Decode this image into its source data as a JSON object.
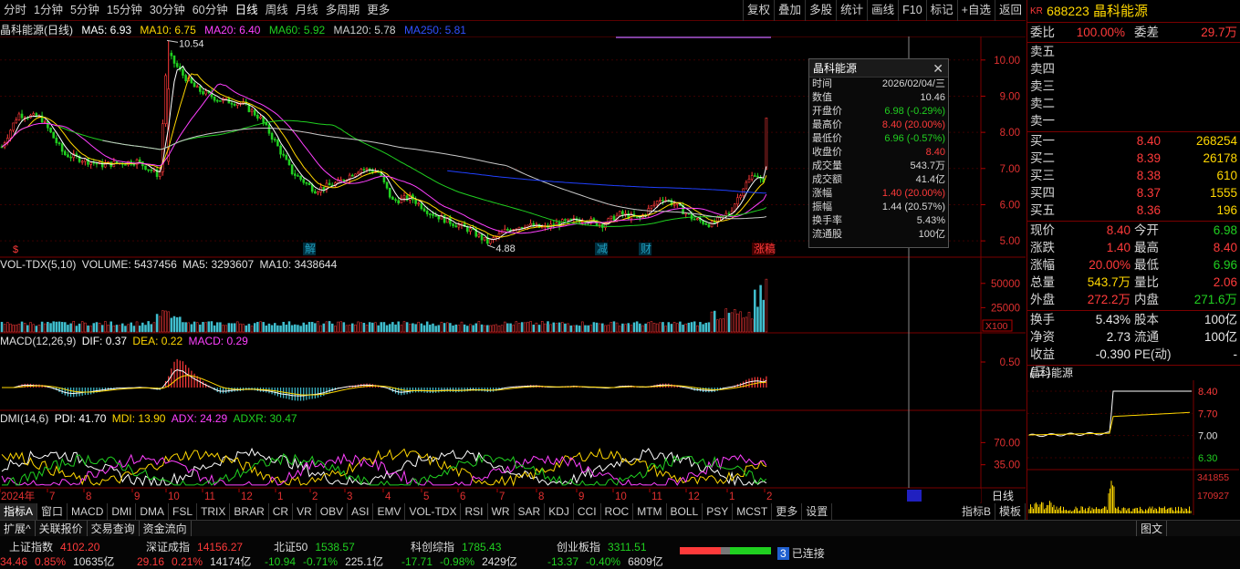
{
  "toolbar": {
    "periods": [
      "分时",
      "1分钟",
      "5分钟",
      "15分钟",
      "30分钟",
      "60分钟",
      "日线",
      "周线",
      "月线",
      "多周期",
      "更多"
    ],
    "active_period": "日线",
    "right_tools": [
      "复权",
      "叠加",
      "多股",
      "统计",
      "画线",
      "F10",
      "标记",
      "+自选",
      "返回"
    ]
  },
  "chart_title": {
    "name": "晶科能源(日线)",
    "ma5": "MA5: 6.93",
    "ma10": "MA10: 6.75",
    "ma20": "MA20: 6.40",
    "ma60": "MA60: 5.92",
    "ma120": "MA120: 5.78",
    "ma250": "MA250: 5.81"
  },
  "colors": {
    "up": "#ff3a3a",
    "down": "#20d020",
    "ma5": "#ffffff",
    "ma10": "#ffd700",
    "ma20": "#ff40ff",
    "ma60": "#20d020",
    "ma120": "#c8c8c8",
    "ma250": "#2040ff",
    "panel_border": "#7a0000",
    "gold": "#ffd700"
  },
  "price_axis": [
    "10.00",
    "9.00",
    "8.00",
    "7.00",
    "6.00",
    "5.00"
  ],
  "chart_annotations": {
    "high": "10.54",
    "low": "4.88",
    "markers": [
      "解",
      "减",
      "财",
      "涨稿"
    ]
  },
  "volume_panel": {
    "label": "VOL-TDX(5,10)",
    "volume": "VOLUME: 5437456",
    "ma5": "MA5: 3293607",
    "ma10": "MA10: 3438644",
    "axis": [
      "50000",
      "25000"
    ],
    "unit": "X100"
  },
  "macd_panel": {
    "label": "MACD(12,26,9)",
    "dif": "DIF: 0.37",
    "dea": "DEA: 0.22",
    "macd": "MACD: 0.29",
    "axis": [
      "0.50"
    ]
  },
  "dmi_panel": {
    "label": "DMI(14,6)",
    "pdi": "PDI: 41.70",
    "mdi": "MDI: 13.90",
    "adx": "ADX: 24.29",
    "adxr": "ADXR: 30.47",
    "axis": [
      "70.00",
      "35.00"
    ]
  },
  "date_axis": {
    "labels": [
      "2024年",
      "7",
      "8",
      "9",
      "10",
      "11",
      "12",
      "1",
      "2",
      "3",
      "4",
      "5",
      "6",
      "7",
      "8",
      "9",
      "10",
      "11",
      "12",
      "1",
      "2"
    ],
    "tag": "日线"
  },
  "popup": {
    "title": "晶科能源",
    "rows": [
      {
        "k": "时间",
        "v": "2026/02/04/三",
        "c": ""
      },
      {
        "k": "数值",
        "v": "10.46",
        "c": ""
      },
      {
        "k": "开盘价",
        "v": "6.98 (-0.29%)",
        "c": "green"
      },
      {
        "k": "最高价",
        "v": "8.40 (20.00%)",
        "c": "red"
      },
      {
        "k": "最低价",
        "v": "6.96 (-0.57%)",
        "c": "green"
      },
      {
        "k": "收盘价",
        "v": "8.40",
        "c": "red"
      },
      {
        "k": "成交量",
        "v": "543.7万",
        "c": ""
      },
      {
        "k": "成交额",
        "v": "41.4亿",
        "c": ""
      },
      {
        "k": "涨幅",
        "v": "1.40 (20.00%)",
        "c": "red"
      },
      {
        "k": "振幅",
        "v": "1.44 (20.57%)",
        "c": ""
      },
      {
        "k": "换手率",
        "v": "5.43%",
        "c": ""
      },
      {
        "k": "流通股",
        "v": "100亿",
        "c": ""
      }
    ]
  },
  "indicator_tabs": [
    "指标A",
    "窗口",
    "MACD",
    "DMI",
    "DMA",
    "FSL",
    "TRIX",
    "BRAR",
    "CR",
    "VR",
    "OBV",
    "ASI",
    "EMV",
    "VOL-TDX",
    "RSI",
    "WR",
    "SAR",
    "KDJ",
    "CCI",
    "ROC",
    "MTM",
    "BOLL",
    "PSY",
    "MCST",
    "更多",
    "设置"
  ],
  "indicator_right": [
    "指标B",
    "模板"
  ],
  "bottom_tabs": [
    "扩展^",
    "关联报价",
    "交易查询",
    "资金流向"
  ],
  "bottom_right": "图文",
  "quote": {
    "badge": "KR",
    "code": "688223",
    "name": "晶科能源",
    "weibi_label": "委比",
    "weibi": "100.00%",
    "weicha_label": "委差",
    "weicha": "29.7万",
    "sells": [
      {
        "label": "卖五",
        "price": "",
        "vol": ""
      },
      {
        "label": "卖四",
        "price": "",
        "vol": ""
      },
      {
        "label": "卖三",
        "price": "",
        "vol": ""
      },
      {
        "label": "卖二",
        "price": "",
        "vol": ""
      },
      {
        "label": "卖一",
        "price": "",
        "vol": ""
      }
    ],
    "buys": [
      {
        "label": "买一",
        "price": "8.40",
        "vol": "268254"
      },
      {
        "label": "买二",
        "price": "8.39",
        "vol": "26178"
      },
      {
        "label": "买三",
        "price": "8.38",
        "vol": "610"
      },
      {
        "label": "买四",
        "price": "8.37",
        "vol": "1555"
      },
      {
        "label": "买五",
        "price": "8.36",
        "vol": "196"
      }
    ],
    "stats": [
      {
        "l1": "现价",
        "v1": "8.40",
        "c1": "red",
        "l2": "今开",
        "v2": "6.98",
        "c2": "green"
      },
      {
        "l1": "涨跌",
        "v1": "1.40",
        "c1": "red",
        "l2": "最高",
        "v2": "8.40",
        "c2": "red"
      },
      {
        "l1": "涨幅",
        "v1": "20.00%",
        "c1": "red",
        "l2": "最低",
        "v2": "6.96",
        "c2": "green"
      },
      {
        "l1": "总量",
        "v1": "543.7万",
        "c1": "yellow",
        "l2": "量比",
        "v2": "2.06",
        "c2": "red"
      },
      {
        "l1": "外盘",
        "v1": "272.2万",
        "c1": "red",
        "l2": "内盘",
        "v2": "271.6万",
        "c2": "green"
      }
    ],
    "stats2": [
      {
        "l1": "换手",
        "v1": "5.43%",
        "c1": "white",
        "l2": "股本",
        "v2": "100亿",
        "c2": "white"
      },
      {
        "l1": "净资",
        "v1": "2.73",
        "c1": "white",
        "l2": "流通",
        "v2": "100亿",
        "c2": "white"
      },
      {
        "l1": "收益(三)",
        "v1": "-0.390",
        "c1": "white",
        "l2": "PE(动)",
        "v2": "-",
        "c2": "white"
      }
    ],
    "mini_title": "晶科能源",
    "mini_axis": [
      "8.40",
      "7.70",
      "7.00",
      "6.30"
    ],
    "mini_vol_axis": [
      "341855",
      "170927"
    ]
  },
  "status": {
    "indices": [
      {
        "name": "上证指数",
        "value": "4102.20",
        "chg": "34.46",
        "pct": "0.85%",
        "amt": "10635亿",
        "c": "red"
      },
      {
        "name": "深证成指",
        "value": "14156.27",
        "chg": "29.16",
        "pct": "0.21%",
        "amt": "14174亿",
        "c": "red"
      },
      {
        "name": "北证50",
        "value": "1538.57",
        "chg": "-10.94",
        "pct": "-0.71%",
        "amt": "225.1亿",
        "c": "green"
      },
      {
        "name": "科创综指",
        "value": "1785.43",
        "chg": "-17.71",
        "pct": "-0.98%",
        "amt": "2429亿",
        "c": "green"
      },
      {
        "name": "创业板指",
        "value": "3311.51",
        "chg": "-13.37",
        "pct": "-0.40%",
        "amt": "6809亿",
        "c": "green"
      }
    ],
    "conn_count": "3",
    "conn_text": "已连接"
  }
}
